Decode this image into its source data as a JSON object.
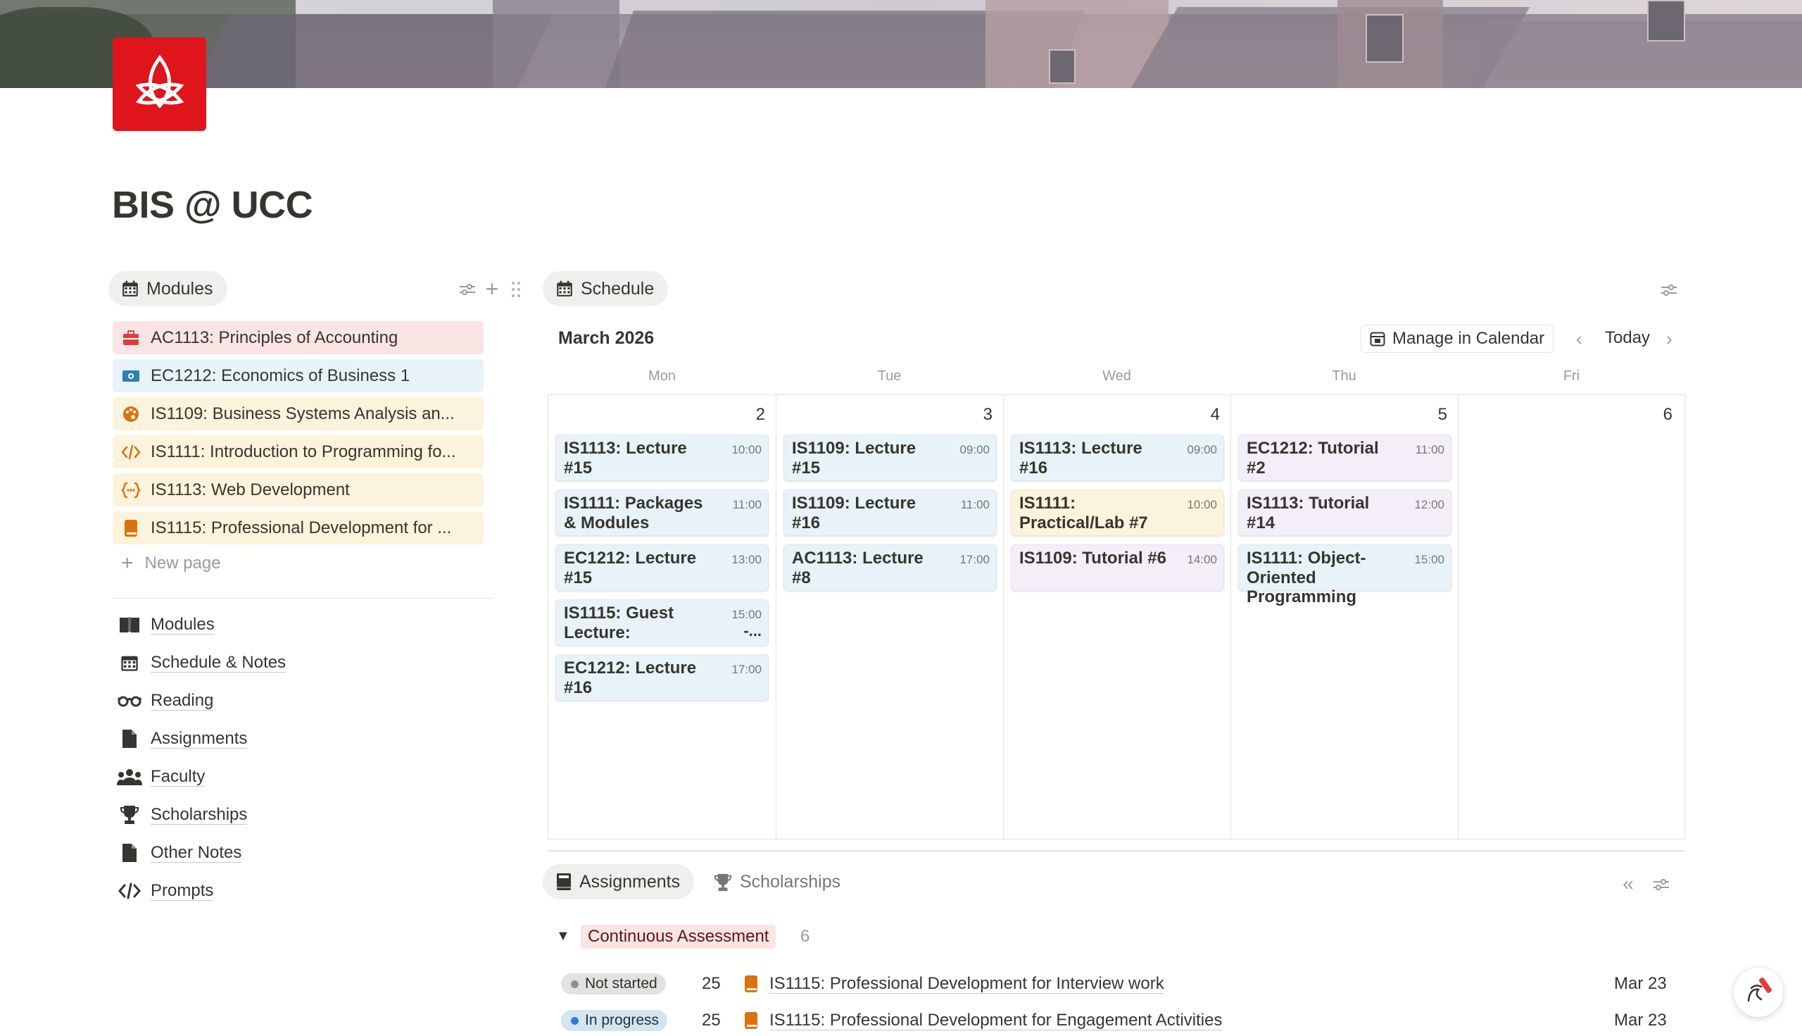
{
  "page": {
    "title": "BIS @ UCC"
  },
  "modules_panel": {
    "tab_label": "Modules",
    "items": [
      {
        "label": "AC1113: Principles of Accounting",
        "icon": "briefcase-icon",
        "bg": "#fbe4e4",
        "icon_color": "#e03e3e"
      },
      {
        "label": "EC1212: Economics of Business 1",
        "icon": "money-icon",
        "bg": "#e7f3f8",
        "icon_color": "#2f80b3"
      },
      {
        "label": "IS1109: Business Systems Analysis an...",
        "icon": "palette-icon",
        "bg": "#fbf3db",
        "icon_color": "#d9730d"
      },
      {
        "label": "IS1111: Introduction to Programming fo...",
        "icon": "code-icon",
        "bg": "#fbf3db",
        "icon_color": "#d9730d"
      },
      {
        "label": "IS1113: Web Development",
        "icon": "code-block-icon",
        "bg": "#fbf3db",
        "icon_color": "#d9730d"
      },
      {
        "label": "IS1115: Professional Development for ...",
        "icon": "book-icon",
        "bg": "#fbf3db",
        "icon_color": "#d9730d"
      }
    ],
    "new_page_label": "New page"
  },
  "nav": {
    "items": [
      {
        "label": "Modules",
        "icon": "book-open-icon"
      },
      {
        "label": "Schedule & Notes",
        "icon": "calendar-icon"
      },
      {
        "label": "Reading",
        "icon": "glasses-icon"
      },
      {
        "label": "Assignments",
        "icon": "document-icon"
      },
      {
        "label": "Faculty",
        "icon": "people-icon"
      },
      {
        "label": "Scholarships",
        "icon": "trophy-icon"
      },
      {
        "label": "Other Notes",
        "icon": "document-icon"
      },
      {
        "label": "Prompts",
        "icon": "code-icon"
      }
    ]
  },
  "schedule": {
    "tab_label": "Schedule",
    "month": "March 2026",
    "manage_label": "Manage in Calendar",
    "today_label": "Today",
    "days": [
      {
        "name": "Mon",
        "num": "2",
        "events": [
          {
            "title": "IS1113: Lecture #15",
            "time": "10:00",
            "color": "blue"
          },
          {
            "title": "IS1111: Packages & Modules",
            "time": "11:00",
            "color": "blue"
          },
          {
            "title": "EC1212: Lecture #15",
            "time": "13:00",
            "color": "blue"
          },
          {
            "title": "IS1115: Guest Lecture:",
            "time": "15:00",
            "extra": "-...",
            "color": "blue"
          },
          {
            "title": "EC1212: Lecture #16",
            "time": "17:00",
            "color": "blue"
          }
        ]
      },
      {
        "name": "Tue",
        "num": "3",
        "events": [
          {
            "title": "IS1109: Lecture #15",
            "time": "09:00",
            "color": "blue"
          },
          {
            "title": "IS1109: Lecture #16",
            "time": "11:00",
            "color": "blue"
          },
          {
            "title": "AC1113: Lecture #8",
            "time": "17:00",
            "color": "blue"
          }
        ]
      },
      {
        "name": "Wed",
        "num": "4",
        "events": [
          {
            "title": "IS1113: Lecture #16",
            "time": "09:00",
            "color": "blue"
          },
          {
            "title": "IS1111: Practical/Lab #7",
            "time": "10:00",
            "color": "yellow"
          },
          {
            "title": "IS1109: Tutorial #6",
            "time": "14:00",
            "color": "purple"
          }
        ]
      },
      {
        "name": "Thu",
        "num": "5",
        "events": [
          {
            "title": "EC1212: Tutorial #2",
            "time": "11:00",
            "color": "purple"
          },
          {
            "title": "IS1113: Tutorial #14",
            "time": "12:00",
            "color": "purple"
          },
          {
            "title": "IS1111: Object-Oriented Programming",
            "time": "15:00",
            "color": "blue"
          }
        ]
      },
      {
        "name": "Fri",
        "num": "6",
        "events": []
      }
    ]
  },
  "assignments": {
    "tabs": [
      {
        "label": "Assignments",
        "icon": "notebook-icon",
        "active": true
      },
      {
        "label": "Scholarships",
        "icon": "trophy-icon",
        "active": false
      }
    ],
    "group": {
      "name": "Continuous Assessment",
      "count": "6"
    },
    "rows": [
      {
        "status": "Not started",
        "status_color": "gray",
        "weight": "25",
        "title": "IS1115: Professional Development for Interview work",
        "date": "Mar 23"
      },
      {
        "status": "In progress",
        "status_color": "blue",
        "weight": "25",
        "title": "IS1115: Professional Development for Engagement Activities",
        "date": "Mar 23"
      }
    ]
  },
  "colors": {
    "accent_red": "#e0141b",
    "event_blue": "#e7f3f8",
    "event_yellow": "#fbf3db",
    "event_purple": "#f4eef8"
  }
}
